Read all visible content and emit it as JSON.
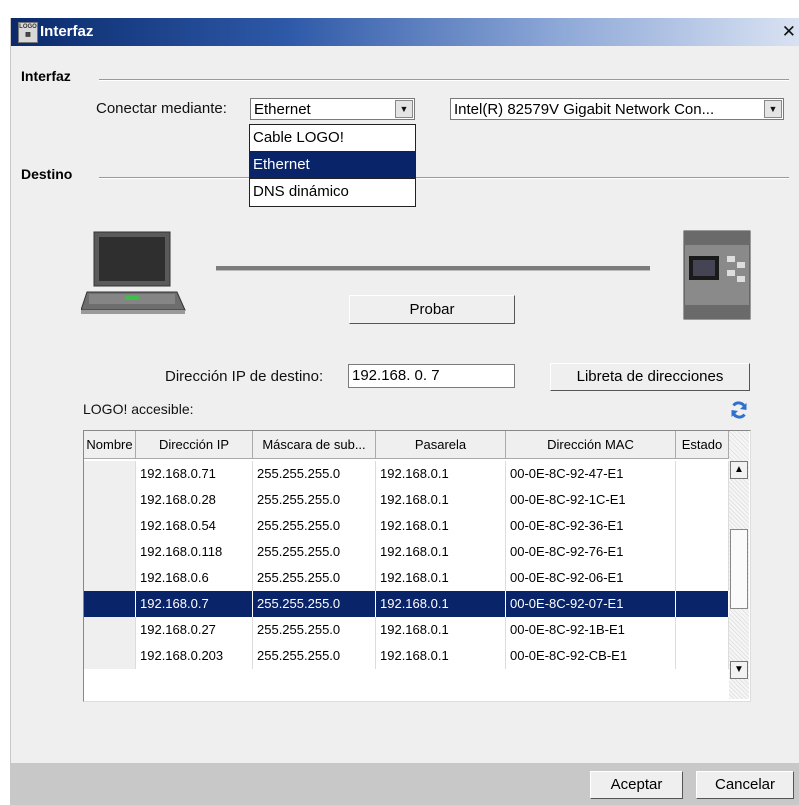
{
  "window": {
    "title": "Interfaz",
    "close_glyph": "✕"
  },
  "interface": {
    "section_title": "Interfaz",
    "connect_label": "Conectar mediante:",
    "connect_value": "Ethernet",
    "adapter_value": "Intel(R) 82579V Gigabit Network Con...",
    "dropdown_options": [
      "Cable LOGO!",
      "Ethernet",
      "DNS dinámico"
    ],
    "dropdown_selected": "Ethernet"
  },
  "destination": {
    "section_title": "Destino",
    "test_button": "Probar",
    "ip_label": "Dirección IP de destino:",
    "ip_value": "192.168.  0.  7",
    "address_book_button": "Libreta de direcciones",
    "accessible_label": "LOGO! accesible:",
    "refresh_icon": "refresh-icon"
  },
  "table": {
    "headers": [
      "Nombre",
      "Dirección IP",
      "Máscara de sub...",
      "Pasarela",
      "Dirección MAC",
      "Estado"
    ],
    "rows": [
      [
        "",
        "192.168.0.71",
        "255.255.255.0",
        "192.168.0.1",
        "00-0E-8C-92-47-E1",
        ""
      ],
      [
        "",
        "192.168.0.28",
        "255.255.255.0",
        "192.168.0.1",
        "00-0E-8C-92-1C-E1",
        ""
      ],
      [
        "",
        "192.168.0.54",
        "255.255.255.0",
        "192.168.0.1",
        "00-0E-8C-92-36-E1",
        ""
      ],
      [
        "",
        "192.168.0.118",
        "255.255.255.0",
        "192.168.0.1",
        "00-0E-8C-92-76-E1",
        ""
      ],
      [
        "",
        "192.168.0.6",
        "255.255.255.0",
        "192.168.0.1",
        "00-0E-8C-92-06-E1",
        ""
      ],
      [
        "",
        "192.168.0.7",
        "255.255.255.0",
        "192.168.0.1",
        "00-0E-8C-92-07-E1",
        ""
      ],
      [
        "",
        "192.168.0.27",
        "255.255.255.0",
        "192.168.0.1",
        "00-0E-8C-92-1B-E1",
        ""
      ],
      [
        "",
        "192.168.0.203",
        "255.255.255.0",
        "192.168.0.1",
        "00-0E-8C-92-CB-E1",
        ""
      ]
    ],
    "selected_row": 5
  },
  "footer": {
    "accept": "Aceptar",
    "cancel": "Cancelar"
  },
  "colors": {
    "selection": "#0a246a",
    "title_start": "#0a2a6b",
    "refresh": "#2f6fd0"
  }
}
